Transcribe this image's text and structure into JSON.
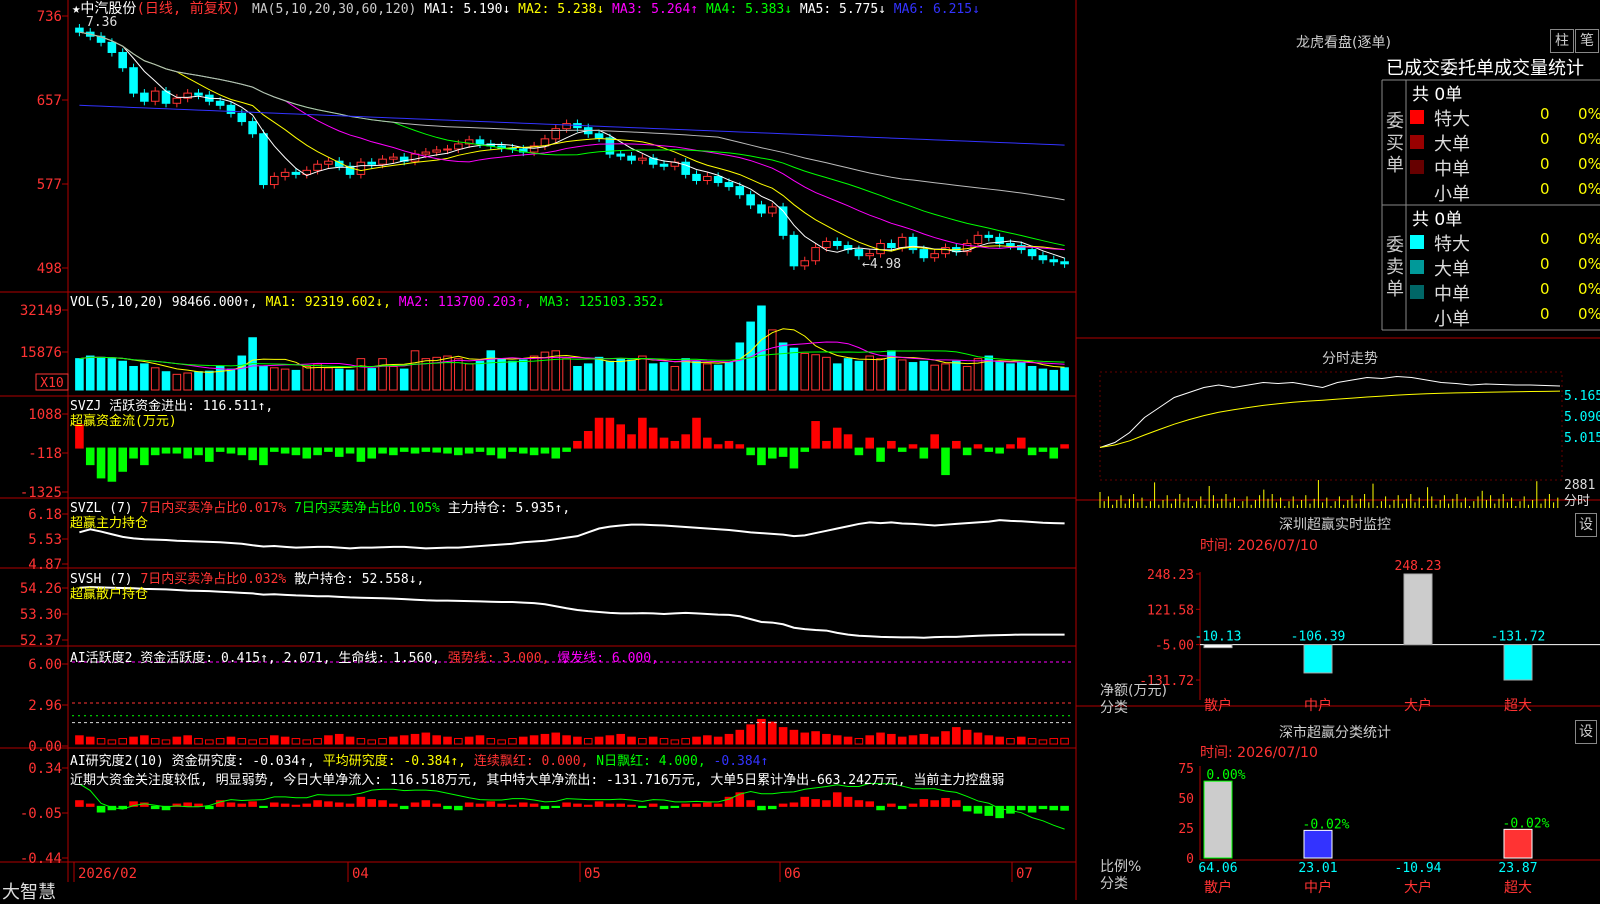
{
  "stock": {
    "title": "★中汽股份",
    "period": "(日线, 前复权)"
  },
  "ma_line": [
    {
      "text": "MA(5,10,20,30,60,120)",
      "color": "#cccccc"
    },
    {
      "text": " MA1: 5.190↓",
      "color": "#ffffff"
    },
    {
      "text": " MA2: 5.238↓",
      "color": "#ffff00"
    },
    {
      "text": " MA3: 5.264↑",
      "color": "#ff00ff"
    },
    {
      "text": " MA4: 5.383↓",
      "color": "#00ff00"
    },
    {
      "text": " MA5: 5.775↓",
      "color": "#ffffff"
    },
    {
      "text": " MA6: 6.215↓",
      "color": "#3333ff"
    }
  ],
  "price_axis": [
    "736",
    "657",
    "577",
    "498"
  ],
  "price_markers": {
    "high": "7.36",
    "low": "←4.98"
  },
  "vol_line": [
    {
      "text": "VOL(5,10,20) 98466.000↑,",
      "color": "#ffffff"
    },
    {
      "text": " MA1: 92319.602↓,",
      "color": "#ffff00"
    },
    {
      "text": " MA2: 113700.203↑,",
      "color": "#ff00ff"
    },
    {
      "text": " MA3: 125103.352↓",
      "color": "#00ff00"
    }
  ],
  "vol_axis": [
    "32149",
    "15876"
  ],
  "vol_unit": "X10",
  "svzj_line": [
    {
      "text": "SVZJ  活跃资金进出: 116.511↑,",
      "color": "#ffffff"
    }
  ],
  "svzj_sub": "超赢资金流(万元)",
  "svzj_axis": [
    "1088",
    "-118",
    "-1325"
  ],
  "svzl_line": [
    {
      "text": "SVZL (7) ",
      "color": "#ffffff"
    },
    {
      "text": "7日内买卖净占比0.017% ",
      "color": "#ff3333"
    },
    {
      "text": "7日内买卖净占比0.105% ",
      "color": "#00ff00"
    },
    {
      "text": "主力持仓: 5.935↑,",
      "color": "#ffffff"
    }
  ],
  "svzl_sub": "超赢主力持仓",
  "svzl_axis": [
    "6.18",
    "5.53",
    "4.87"
  ],
  "svsh_line": [
    {
      "text": "SVSH (7) ",
      "color": "#ffffff"
    },
    {
      "text": "7日内买卖净占比0.032% ",
      "color": "#ff3333"
    },
    {
      "text": "散户持仓: 52.558↓,",
      "color": "#ffffff"
    }
  ],
  "svsh_sub": "超赢散户持仓",
  "svsh_axis": [
    "54.26",
    "53.30",
    "52.37"
  ],
  "ai1_line": [
    {
      "text": "AI活跃度2 资金活跃度: 0.415↑, ",
      "color": "#ffffff"
    },
    {
      "text": "2.071, 生命线: 1.560, ",
      "color": "#ffffff"
    },
    {
      "text": "强势线: 3.000, ",
      "color": "#ff3333"
    },
    {
      "text": "爆发线: 6.000,",
      "color": "#ff00ff"
    }
  ],
  "ai1_axis": [
    "6.00",
    "2.96",
    "0.00"
  ],
  "ai2_line": [
    {
      "text": "AI研究度2(10) 资金研究度: -0.034↑, ",
      "color": "#ffffff"
    },
    {
      "text": "平均研究度: -0.384↑, ",
      "color": "#ffff00"
    },
    {
      "text": "连续飘红: 0.000, ",
      "color": "#ff3333"
    },
    {
      "text": "N日飘红: 4.000, ",
      "color": "#00ff00"
    },
    {
      "text": "-0.384↑",
      "color": "#3333ff"
    }
  ],
  "ai2_comment": "近期大资金关注度较低, 明显弱势, 今日大单净流入: 116.518万元, 其中特大单净流出: -131.716万元, 大单5日累计净出-663.242万元, 当前主力控盘弱",
  "ai2_axis": [
    "0.34",
    "-0.05",
    "-0.44"
  ],
  "brand": "大智慧",
  "date_axis": [
    "2026/02",
    "04",
    "05",
    "06",
    "07"
  ],
  "right": {
    "lhb_title": "龙虎看盘(逐单)",
    "btn1": "柱",
    "btn2": "笔",
    "tab_title": "已成交委托单成交量统计",
    "buy_label": "委买单",
    "buy_total": "共 0单",
    "sell_label": "委卖单",
    "sell_total": "共 0单",
    "buy_rows": [
      {
        "name": "特大",
        "value": "0",
        "pct": "0%",
        "color": "#ff0000"
      },
      {
        "name": "大单",
        "value": "0",
        "pct": "0%",
        "color": "#990000"
      },
      {
        "name": "中单",
        "value": "0",
        "pct": "0%",
        "color": "#660000"
      },
      {
        "name": "小单",
        "value": "0",
        "pct": "0%",
        "color": ""
      }
    ],
    "sell_rows": [
      {
        "name": "特大",
        "value": "0",
        "pct": "0%",
        "color": "#00ffff"
      },
      {
        "name": "大单",
        "value": "0",
        "pct": "0%",
        "color": "#009999"
      },
      {
        "name": "中单",
        "value": "0",
        "pct": "0%",
        "color": "#006666"
      },
      {
        "name": "小单",
        "value": "0",
        "pct": "0%",
        "color": ""
      }
    ],
    "fs_title": "分时走势",
    "fs_axis": [
      "5.165",
      "5.090",
      "5.015"
    ],
    "fs_vol_axis": [
      "2881",
      "分时"
    ],
    "mon_title": "深圳超赢实时监控",
    "mon_btn": "设",
    "mon_date": "时间: 2026/07/10",
    "mon_axis": [
      "248.23",
      "121.58",
      "-5.00",
      "-131.72"
    ],
    "mon_ylabel1": "净额(万元)",
    "mon_ylabel2": "分类",
    "stat_title": "深市超赢分类统计",
    "stat_btn": "设",
    "stat_date": "时间: 2026/07/10",
    "stat_axis": [
      "75",
      "50",
      "25",
      "0"
    ],
    "stat_ylabel1": "比例%",
    "stat_ylabel2": "分类"
  },
  "chart_data": [
    {
      "type": "candlestick",
      "title": "中汽股份 (日线, 前复权)",
      "x_range": [
        "2026/02",
        "2026/07/10"
      ],
      "ylim": [
        4.9,
        7.4
      ],
      "closes": [
        7.3,
        7.26,
        7.2,
        7.1,
        6.95,
        6.7,
        6.62,
        6.72,
        6.6,
        6.65,
        6.7,
        6.68,
        6.62,
        6.58,
        6.5,
        6.42,
        6.3,
        5.8,
        5.88,
        5.92,
        5.9,
        5.94,
        6.0,
        6.03,
        5.98,
        5.9,
        6.02,
        6.0,
        6.05,
        6.07,
        6.03,
        6.1,
        6.12,
        6.14,
        6.15,
        6.2,
        6.24,
        6.2,
        6.18,
        6.16,
        6.15,
        6.12,
        6.18,
        6.25,
        6.35,
        6.4,
        6.36,
        6.3,
        6.26,
        6.1,
        6.08,
        6.04,
        6.06,
        6.0,
        5.98,
        6.02,
        5.9,
        5.84,
        5.88,
        5.82,
        5.78,
        5.7,
        5.6,
        5.52,
        5.58,
        5.3,
        5.0,
        5.05,
        5.18,
        5.24,
        5.2,
        5.16,
        5.1,
        5.12,
        5.22,
        5.18,
        5.28,
        5.16,
        5.08,
        5.12,
        5.18,
        5.14,
        5.22,
        5.3,
        5.28,
        5.22,
        5.2,
        5.16,
        5.1,
        5.06,
        5.04,
        5.02
      ],
      "ma_latest": {
        "MA1": 5.19,
        "MA2": 5.238,
        "MA3": 5.264,
        "MA4": 5.383,
        "MA5": 5.775,
        "MA6": 6.215
      },
      "high": 7.36,
      "low": 4.98
    },
    {
      "type": "bar",
      "title": "VOL(5,10,20)",
      "values": [
        12000,
        13000,
        12500,
        12000,
        11000,
        9000,
        10000,
        8500,
        7000,
        6000,
        6500,
        7000,
        7200,
        9000,
        8000,
        13000,
        20000,
        9000,
        8500,
        8000,
        7500,
        9000,
        10000,
        8500,
        8000,
        7600,
        12000,
        8200,
        12000,
        9000,
        8000,
        15000,
        12000,
        12500,
        13000,
        12000,
        10000,
        11000,
        15000,
        12000,
        11000,
        11500,
        13000,
        14500,
        15000,
        12000,
        9000,
        10000,
        12500,
        11000,
        12000,
        11500,
        13000,
        10000,
        10500,
        9000,
        12000,
        11000,
        10000,
        9500,
        10500,
        18000,
        26000,
        32149,
        23000,
        18000,
        16000,
        14000,
        13500,
        12500,
        10000,
        12000,
        11000,
        13000,
        12000,
        15000,
        11500,
        10500,
        11000,
        9500,
        10000,
        11000,
        9000,
        12000,
        13000,
        11000,
        10000,
        10500,
        9000,
        8000,
        7500,
        8500
      ],
      "ylim": [
        0,
        32149
      ],
      "latest": {
        "VOL": 98466.0,
        "MA1": 92319.602,
        "MA2": 113700.203,
        "MA3": 125103.352
      }
    },
    {
      "type": "bar",
      "title": "SVZJ 活跃资金进出",
      "values": [
        700,
        -500,
        -900,
        -1000,
        -700,
        -300,
        -500,
        -200,
        -150,
        -150,
        -300,
        -200,
        -400,
        -100,
        -150,
        -200,
        -350,
        -500,
        -100,
        -150,
        -200,
        -300,
        -200,
        -100,
        -250,
        -150,
        -400,
        -300,
        -150,
        -200,
        -100,
        -150,
        -100,
        -120,
        -150,
        -200,
        -150,
        -100,
        -200,
        -300,
        -100,
        -150,
        -200,
        -150,
        -300,
        -100,
        200,
        500,
        900,
        900,
        700,
        400,
        900,
        600,
        300,
        200,
        400,
        900,
        300,
        100,
        200,
        100,
        -200,
        -500,
        -300,
        -250,
        -600,
        -100,
        800,
        200,
        600,
        400,
        -200,
        300,
        -400,
        200,
        -100,
        100,
        -300,
        400,
        -800,
        200,
        -200,
        100,
        -100,
        -150,
        100,
        300,
        -200,
        -100,
        -300,
        100
      ],
      "ylim": [
        -1325,
        1088
      ],
      "latest": {
        "活跃资金进出": 116.511
      }
    },
    {
      "type": "line",
      "title": "SVZL (7) 主力持仓",
      "values": [
        5.7,
        5.78,
        5.72,
        5.65,
        5.58,
        5.54,
        5.52,
        5.51,
        5.5,
        5.48,
        5.47,
        5.46,
        5.45,
        5.44,
        5.42,
        5.4,
        5.36,
        5.33,
        5.34,
        5.32,
        5.3,
        5.31,
        5.32,
        5.32,
        5.3,
        5.28,
        5.3,
        5.3,
        5.31,
        5.32,
        5.32,
        5.3,
        5.28,
        5.29,
        5.3,
        5.3,
        5.32,
        5.34,
        5.36,
        5.38,
        5.4,
        5.44,
        5.46,
        5.48,
        5.52,
        5.56,
        5.6,
        5.7,
        5.8,
        5.85,
        5.88,
        5.9,
        5.9,
        5.89,
        5.88,
        5.86,
        5.84,
        5.82,
        5.8,
        5.78,
        5.76,
        5.73,
        5.7,
        5.68,
        5.66,
        5.64,
        5.6,
        5.62,
        5.68,
        5.74,
        5.8,
        5.86,
        5.92,
        5.96,
        5.94,
        5.96,
        5.93,
        5.92,
        5.9,
        5.88,
        5.9,
        5.92,
        5.94,
        5.96,
        5.98,
        6.02,
        6.0,
        5.99,
        5.97,
        5.95,
        5.94,
        5.935
      ],
      "ylim": [
        4.87,
        6.18
      ],
      "latest": {
        "主力持仓": 5.935
      }
    },
    {
      "type": "line",
      "title": "SVSH (7) 散户持仓",
      "values": [
        54.2,
        54.22,
        54.21,
        54.2,
        54.19,
        54.18,
        54.16,
        54.15,
        54.14,
        54.12,
        54.1,
        54.09,
        54.08,
        54.06,
        54.04,
        54.02,
        54.0,
        53.96,
        53.97,
        53.95,
        53.93,
        53.92,
        53.9,
        53.9,
        53.88,
        53.86,
        53.85,
        53.84,
        53.83,
        53.82,
        53.8,
        53.78,
        53.76,
        53.75,
        53.75,
        53.74,
        53.73,
        53.72,
        53.71,
        53.7,
        53.7,
        53.68,
        53.66,
        53.62,
        53.55,
        53.48,
        53.42,
        53.38,
        53.35,
        53.32,
        53.3,
        53.3,
        53.31,
        53.3,
        53.28,
        53.3,
        53.32,
        53.3,
        53.28,
        53.26,
        53.25,
        53.2,
        53.1,
        53.0,
        52.98,
        52.92,
        52.8,
        52.75,
        52.72,
        52.7,
        52.62,
        52.56,
        52.52,
        52.5,
        52.48,
        52.47,
        52.46,
        52.46,
        52.45,
        52.47,
        52.48,
        52.48,
        52.5,
        52.52,
        52.53,
        52.54,
        52.55,
        52.56,
        52.56,
        52.56,
        52.56,
        52.558
      ],
      "ylim": [
        52.37,
        54.26
      ],
      "latest": {
        "散户持仓": 52.558
      }
    },
    {
      "type": "bar",
      "title": "AI活跃度2",
      "values": [
        0.6,
        0.5,
        0.4,
        0.3,
        0.4,
        0.5,
        0.6,
        0.4,
        0.3,
        0.5,
        0.6,
        0.4,
        0.3,
        0.4,
        0.5,
        0.4,
        0.3,
        0.4,
        0.6,
        0.5,
        0.4,
        0.3,
        0.4,
        0.6,
        0.7,
        0.5,
        0.4,
        0.3,
        0.4,
        0.5,
        0.6,
        0.7,
        0.8,
        0.6,
        0.5,
        0.4,
        0.5,
        0.6,
        0.4,
        0.3,
        0.4,
        0.5,
        0.6,
        0.7,
        0.8,
        0.6,
        0.5,
        0.4,
        0.5,
        0.6,
        0.7,
        0.5,
        0.4,
        0.5,
        0.4,
        0.3,
        0.4,
        0.5,
        0.6,
        0.5,
        0.7,
        1.0,
        1.4,
        1.8,
        1.6,
        1.2,
        1.0,
        0.8,
        0.9,
        0.7,
        0.6,
        0.5,
        0.4,
        0.6,
        0.8,
        0.7,
        0.5,
        0.6,
        0.7,
        0.5,
        0.9,
        1.2,
        1.0,
        0.8,
        0.6,
        0.5,
        0.4,
        0.5,
        0.4,
        0.3,
        0.4,
        0.415
      ],
      "ylim": [
        0,
        6
      ],
      "latest": {
        "资金活跃度": 0.415,
        "生命线": 1.56,
        "强势线": 3.0,
        "爆发线": 6.0
      }
    },
    {
      "type": "bar",
      "title": "AI研究度2(10)",
      "values": [
        0.05,
        0.02,
        -0.05,
        -0.03,
        -0.02,
        0.04,
        0.03,
        -0.02,
        -0.03,
        0.02,
        0.03,
        0.02,
        -0.02,
        0.05,
        0.03,
        0.02,
        0.04,
        -0.01,
        0.03,
        0.02,
        0.01,
        0.02,
        0.05,
        0.04,
        0.03,
        0.02,
        0.08,
        0.06,
        0.05,
        0.02,
        -0.02,
        0.03,
        0.05,
        0.02,
        -0.02,
        -0.03,
        0.03,
        0.02,
        0.04,
        0.02,
        0.01,
        0.03,
        0.02,
        -0.02,
        -0.01,
        0.03,
        0.02,
        0.01,
        0.04,
        0.02,
        0.02,
        0.01,
        -0.01,
        0.02,
        -0.02,
        -0.01,
        0.02,
        0.02,
        0.03,
        0.02,
        0.08,
        0.12,
        0.05,
        -0.03,
        -0.02,
        0.02,
        0.03,
        0.08,
        0.06,
        0.05,
        0.12,
        0.08,
        0.05,
        0.04,
        -0.03,
        0.02,
        -0.02,
        0.02,
        0.06,
        0.05,
        0.07,
        0.05,
        -0.04,
        -0.06,
        -0.08,
        -0.1,
        -0.06,
        -0.03,
        -0.05,
        -0.02,
        -0.03,
        -0.034
      ],
      "ylim": [
        -0.44,
        0.34
      ],
      "latest": {
        "资金研究度": -0.034,
        "平均研究度": -0.384,
        "连续飘红": 0.0,
        "N日飘红": 4.0
      }
    },
    {
      "type": "line",
      "title": "分时走势",
      "ylim": [
        5.015,
        5.165
      ],
      "values": [
        5.02,
        5.03,
        5.05,
        5.08,
        5.1,
        5.12,
        5.13,
        5.14,
        5.145,
        5.14,
        5.145,
        5.15,
        5.148,
        5.15,
        5.145,
        5.14,
        5.15,
        5.155,
        5.16,
        5.158,
        5.162,
        5.16,
        5.155,
        5.15,
        5.148,
        5.145,
        5.147,
        5.146,
        5.145,
        5.145,
        5.144,
        5.143
      ]
    },
    {
      "type": "bar",
      "title": "深圳超赢实时监控",
      "categories": [
        "散户",
        "中户",
        "大户",
        "超大"
      ],
      "values": [
        -10.13,
        -106.39,
        248.23,
        -131.72
      ],
      "ylabel": "净额(万元)",
      "ylim": [
        -131.72,
        248.23
      ]
    },
    {
      "type": "bar",
      "title": "深市超赢分类统计",
      "categories": [
        "散户",
        "中户",
        "大户",
        "超大"
      ],
      "values": [
        64.06,
        23.01,
        -10.94,
        23.87
      ],
      "changes": [
        "0.00%",
        "-0.02%",
        "",
        "-0.02%"
      ],
      "ylabel": "比例%",
      "ylim": [
        0,
        75
      ]
    }
  ]
}
